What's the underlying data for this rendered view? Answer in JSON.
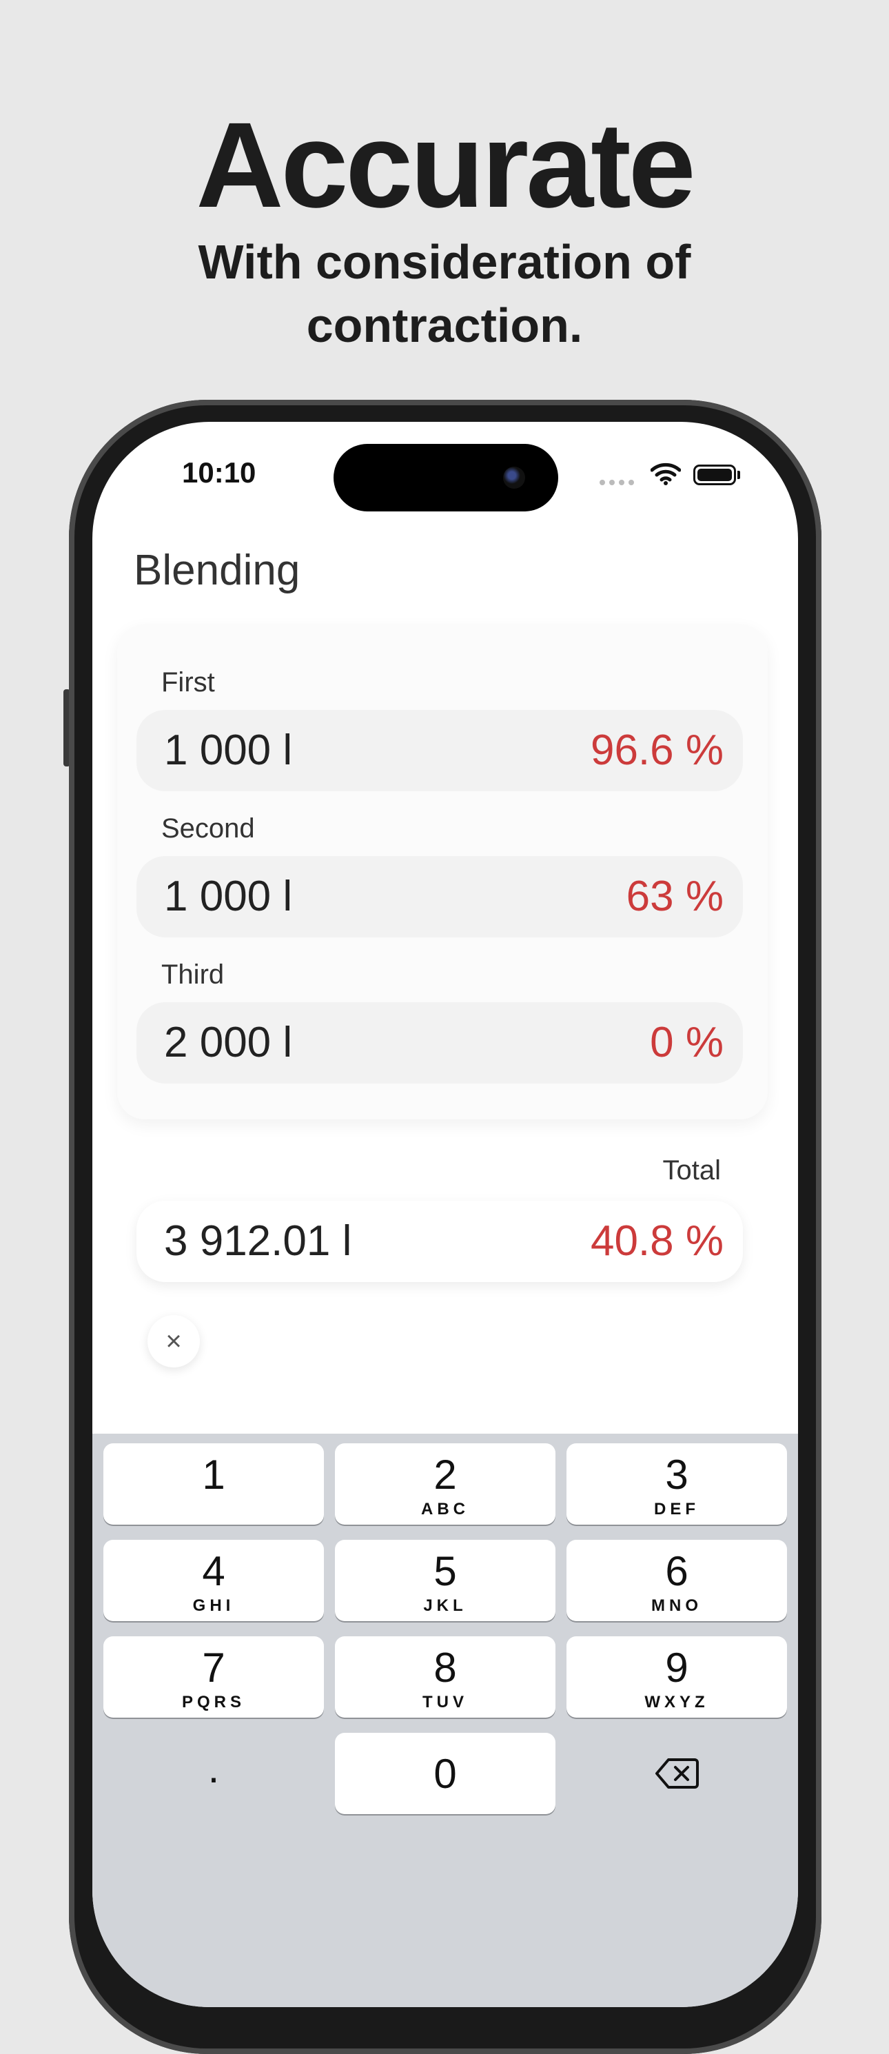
{
  "promo": {
    "headline": "Accurate",
    "subline_1": "With consideration of",
    "subline_2": "contraction."
  },
  "status_bar": {
    "time": "10:10"
  },
  "app": {
    "title": "Blending",
    "inputs": [
      {
        "label": "First",
        "volume": "1 000 l",
        "percent": "96.6 %"
      },
      {
        "label": "Second",
        "volume": "1 000 l",
        "percent": "63 %"
      },
      {
        "label": "Third",
        "volume": "2 000 l",
        "percent": "0 %"
      }
    ],
    "total": {
      "label": "Total",
      "volume": "3 912.01 l",
      "percent": "40.8 %"
    },
    "clear_button": "×",
    "accent_color": "#cc3b3b"
  },
  "keyboard": {
    "keys": [
      {
        "num": "1",
        "letters": ""
      },
      {
        "num": "2",
        "letters": "ABC"
      },
      {
        "num": "3",
        "letters": "DEF"
      },
      {
        "num": "4",
        "letters": "GHI"
      },
      {
        "num": "5",
        "letters": "JKL"
      },
      {
        "num": "6",
        "letters": "MNO"
      },
      {
        "num": "7",
        "letters": "PQRS"
      },
      {
        "num": "8",
        "letters": "TUV"
      },
      {
        "num": "9",
        "letters": "WXYZ"
      },
      {
        "num": ".",
        "letters": ""
      },
      {
        "num": "0",
        "letters": ""
      }
    ],
    "delete_icon": "backspace-icon"
  }
}
